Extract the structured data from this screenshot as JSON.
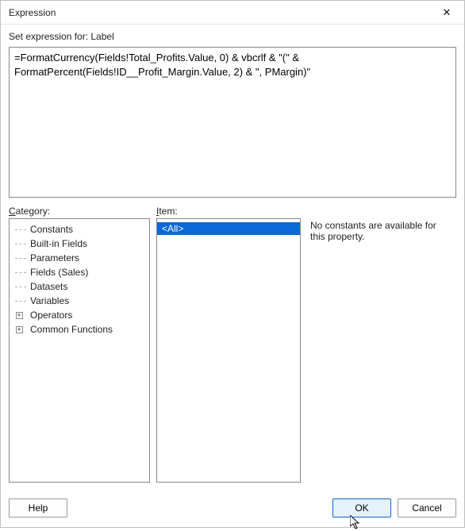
{
  "window": {
    "title": "Expression",
    "close_glyph": "✕"
  },
  "set_for_label": "Set expression for: Label",
  "expression_text": "=FormatCurrency(Fields!Total_Profits.Value, 0) & vbcrlf & \"(\" & FormatPercent(Fields!ID__Profit_Margin.Value, 2) & \", PMargin)\"",
  "labels": {
    "category": "Category:",
    "item": "Item:"
  },
  "category_tree": [
    {
      "label": "Constants",
      "expandable": false
    },
    {
      "label": "Built-in Fields",
      "expandable": false
    },
    {
      "label": "Parameters",
      "expandable": false
    },
    {
      "label": "Fields (Sales)",
      "expandable": false
    },
    {
      "label": "Datasets",
      "expandable": false
    },
    {
      "label": "Variables",
      "expandable": false
    },
    {
      "label": "Operators",
      "expandable": true
    },
    {
      "label": "Common Functions",
      "expandable": true
    }
  ],
  "items": [
    {
      "label": "<All>",
      "selected": true
    }
  ],
  "description_text": "No constants are available for this property.",
  "footer": {
    "help": "Help",
    "ok": "OK",
    "cancel": "Cancel"
  }
}
